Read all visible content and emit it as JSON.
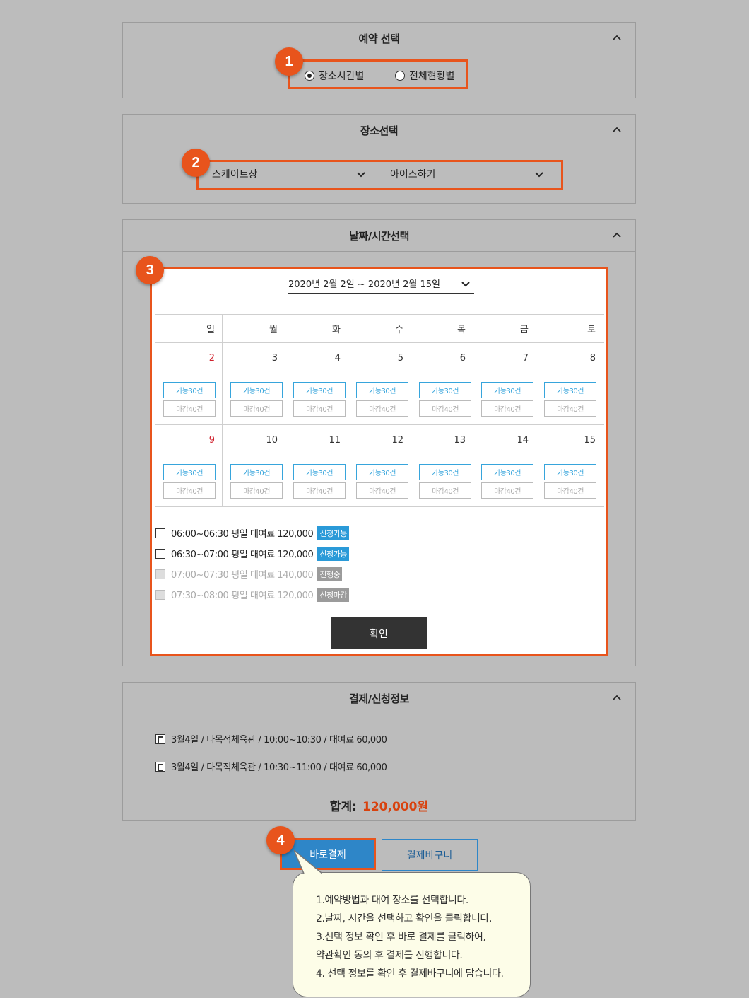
{
  "section1": {
    "title": "예약 선택",
    "badge": "1",
    "options": [
      {
        "label": "장소시간별",
        "selected": true
      },
      {
        "label": "전체현황별",
        "selected": false
      }
    ]
  },
  "section2": {
    "title": "장소선택",
    "badge": "2",
    "venue_select": "스케이트장",
    "facility_select": "아이스하키"
  },
  "section3": {
    "title": "날짜/시간선택",
    "badge": "3",
    "range_select": "2020년 2월 2일 ~ 2020년 2월 15일",
    "weekdays": [
      "일",
      "월",
      "화",
      "수",
      "목",
      "금",
      "토"
    ],
    "weeks": [
      [
        "2",
        "3",
        "4",
        "5",
        "6",
        "7",
        "8"
      ],
      [
        "9",
        "10",
        "11",
        "12",
        "13",
        "14",
        "15"
      ]
    ],
    "avail_label": "가능30건",
    "closed_label": "마감40건",
    "slots": [
      {
        "text": "06:00~06:30 평일 대여료 120,000",
        "tag": "신청가능",
        "enabled": true
      },
      {
        "text": "06:30~07:00 평일 대여료 120,000",
        "tag": "신청가능",
        "enabled": true
      },
      {
        "text": "07:00~07:30 평일 대여료 140,000",
        "tag": "진행중",
        "enabled": false
      },
      {
        "text": "07:30~08:00 평일 대여료 120,000",
        "tag": "신청마감",
        "enabled": false
      }
    ],
    "confirm_label": "확인"
  },
  "section4": {
    "title": "결제/신청정보",
    "items": [
      "3월4일 / 다목적체육관 / 10:00~10:30 / 대여료 60,000",
      "3월4일 / 다목적체육관 / 10:30~11:00 / 대여료 60,000"
    ],
    "total_label": "합계:",
    "total_value": "120,000원"
  },
  "actions": {
    "badge": "4",
    "pay_now": "바로결제",
    "cart": "결제바구니"
  },
  "help": {
    "lines": [
      "1.예약방법과 대여 장소를 선택합니다.",
      "2.날짜, 시간을 선택하고 확인을 클릭합니다.",
      "3.선택 정보 확인 후 바로 결제를 클릭하여,",
      "약관확인 동의 후 결제를 진행합니다.",
      "4. 선택 정보를 확인 후 결제바구니에 담습니다."
    ]
  },
  "colors": {
    "accent_orange": "#e8541c",
    "pay_blue": "#2e86c8",
    "available_blue": "#37a5dc",
    "total_red": "#d8420e",
    "sunday_red": "#d0202c"
  }
}
